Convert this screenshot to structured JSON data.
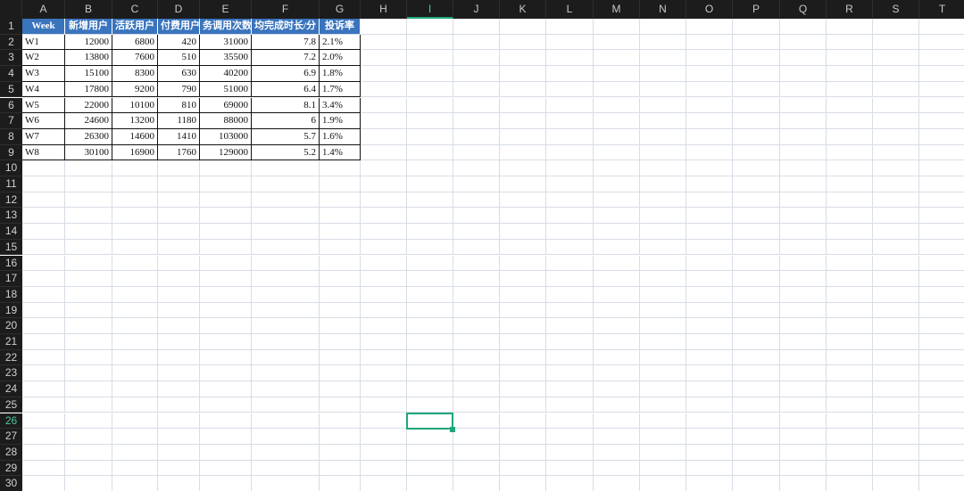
{
  "sheet": {
    "columns": [
      "A",
      "B",
      "C",
      "D",
      "E",
      "F",
      "G",
      "H",
      "I",
      "J",
      "K",
      "L",
      "M",
      "N",
      "O",
      "P",
      "Q",
      "R",
      "S",
      "T"
    ],
    "rows": [
      "1",
      "2",
      "3",
      "4",
      "5",
      "6",
      "7",
      "8",
      "9",
      "10",
      "11",
      "12",
      "13",
      "14",
      "15",
      "16",
      "17",
      "18",
      "19",
      "20",
      "21",
      "22",
      "23",
      "24",
      "25",
      "26",
      "27",
      "28",
      "29",
      "30"
    ],
    "selected_column": "I",
    "selected_row": "26",
    "accent_color": "#1fa67a",
    "header_fill_color": "#3a74bd"
  },
  "table": {
    "headers": [
      "Week",
      "新增用户",
      "活跃用户",
      "付费用户",
      "务调用次数",
      "均完成时长/分",
      "投诉率"
    ],
    "rows": [
      [
        "W1",
        "12000",
        "6800",
        "420",
        "31000",
        "7.8",
        "2.1%"
      ],
      [
        "W2",
        "13800",
        "7600",
        "510",
        "35500",
        "7.2",
        "2.0%"
      ],
      [
        "W3",
        "15100",
        "8300",
        "630",
        "40200",
        "6.9",
        "1.8%"
      ],
      [
        "W4",
        "17800",
        "9200",
        "790",
        "51000",
        "6.4",
        "1.7%"
      ],
      [
        "W5",
        "22000",
        "10100",
        "810",
        "69000",
        "8.1",
        "3.4%"
      ],
      [
        "W6",
        "24600",
        "13200",
        "1180",
        "88000",
        "6",
        "1.9%"
      ],
      [
        "W7",
        "26300",
        "14600",
        "1410",
        "103000",
        "5.7",
        "1.6%"
      ],
      [
        "W8",
        "30100",
        "16900",
        "1760",
        "129000",
        "5.2",
        "1.4%"
      ]
    ]
  }
}
